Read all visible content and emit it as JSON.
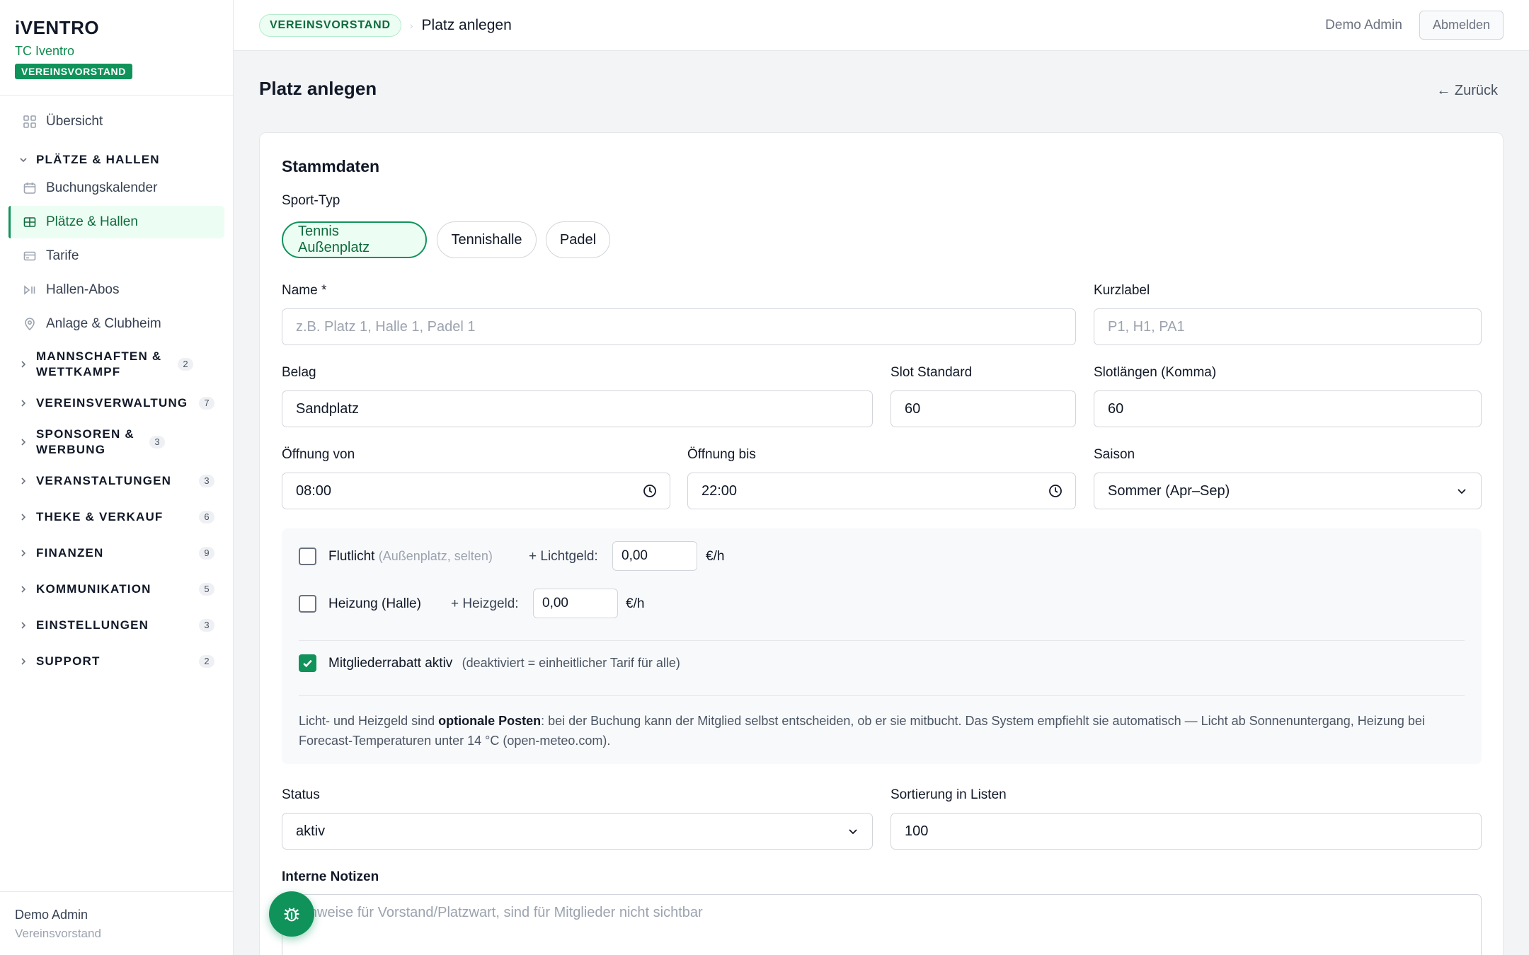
{
  "brand": {
    "logo": "iVENTRO",
    "club": "TC Iventro",
    "role_badge": "VEREINSVORSTAND"
  },
  "nav": {
    "overview": "Übersicht",
    "group_plaetze": "PLÄTZE & HALLEN",
    "booking_calendar": "Buchungskalender",
    "courts_halls": "Plätze & Hallen",
    "rates": "Tarife",
    "hall_subs": "Hallen-Abos",
    "facility": "Anlage & Clubheim",
    "groups": [
      {
        "label": "MANNSCHAFTEN & WETTKAMPF",
        "count": "2"
      },
      {
        "label": "VEREINSVERWALTUNG",
        "count": "7"
      },
      {
        "label": "SPONSOREN & WERBUNG",
        "count": "3"
      },
      {
        "label": "VERANSTALTUNGEN",
        "count": "3"
      },
      {
        "label": "THEKE & VERKAUF",
        "count": "6"
      },
      {
        "label": "FINANZEN",
        "count": "9"
      },
      {
        "label": "KOMMUNIKATION",
        "count": "5"
      },
      {
        "label": "EINSTELLUNGEN",
        "count": "3"
      },
      {
        "label": "SUPPORT",
        "count": "2"
      }
    ]
  },
  "sidebar_footer": {
    "name": "Demo Admin",
    "role": "Vereinsvorstand"
  },
  "topbar": {
    "badge": "VEREINSVORSTAND",
    "separator": "›",
    "title": "Platz anlegen",
    "user": "Demo Admin",
    "logout": "Abmelden"
  },
  "page": {
    "title": "Platz anlegen",
    "back": "← Zurück"
  },
  "form": {
    "section_title": "Stammdaten",
    "sport_type_label": "Sport-Typ",
    "sport_types": [
      "Tennis Außenplatz",
      "Tennishalle",
      "Padel"
    ],
    "name_label": "Name *",
    "name_placeholder": "z.B. Platz 1, Halle 1, Padel 1",
    "short_label_label": "Kurzlabel",
    "short_label_placeholder": "P1, H1, PA1",
    "surface_label": "Belag",
    "surface_value": "Sandplatz",
    "slot_default_label": "Slot Standard",
    "slot_default_value": "60",
    "slot_lengths_label": "Slotlängen (Komma)",
    "slot_lengths_value": "60",
    "open_from_label": "Öffnung von",
    "open_from_value": "08:00",
    "open_to_label": "Öffnung bis",
    "open_to_value": "22:00",
    "season_label": "Saison",
    "season_value": "Sommer (Apr–Sep)",
    "floodlight_label": "Flutlicht",
    "floodlight_note": "(Außenplatz, selten)",
    "light_fee_label": "+ Lichtgeld:",
    "light_fee_value": "0,00",
    "light_fee_unit": "€/h",
    "heating_label": "Heizung (Halle)",
    "heating_fee_label": "+ Heizgeld:",
    "heating_fee_value": "0,00",
    "heating_fee_unit": "€/h",
    "member_discount_label": "Mitgliederrabatt aktiv",
    "member_discount_note": "(deaktiviert = einheitlicher Tarif für alle)",
    "hint_prefix": "Licht- und Heizgeld sind ",
    "hint_bold": "optionale Posten",
    "hint_suffix": ": bei der Buchung kann der Mitglied selbst entscheiden, ob er sie mitbucht. Das System empfiehlt sie automatisch — Licht ab Sonnenuntergang, Heizung bei Forecast-Temperaturen unter 14 °C (open-meteo.com).",
    "status_label": "Status",
    "status_value": "aktiv",
    "sort_label": "Sortierung in Listen",
    "sort_value": "100",
    "notes_label": "Interne Notizen",
    "notes_placeholder": "Hinweise für Vorstand/Platzwart, sind für Mitglieder nicht sichtbar"
  },
  "colors": {
    "accent": "#10935a",
    "accent_light": "#ecfdf3"
  },
  "icons": {
    "fab": "bug-icon",
    "time": "clock-icon",
    "select": "chevron-down-icon"
  }
}
